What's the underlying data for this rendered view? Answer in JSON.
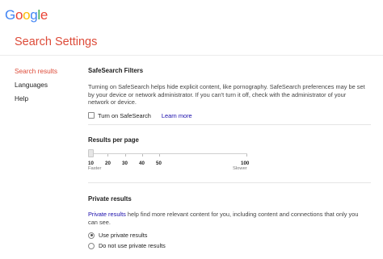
{
  "logo": {
    "text": "Google",
    "letters": [
      "G",
      "o",
      "o",
      "g",
      "l",
      "e"
    ],
    "colors": [
      "#4285F4",
      "#EA4335",
      "#FBBC05",
      "#4285F4",
      "#34A853",
      "#EA4335"
    ]
  },
  "page": {
    "title": "Search Settings"
  },
  "sidebar": {
    "items": [
      {
        "label": "Search results",
        "active": true
      },
      {
        "label": "Languages",
        "active": false
      },
      {
        "label": "Help",
        "active": false
      }
    ]
  },
  "safesearch": {
    "title": "SafeSearch Filters",
    "description": "Turning on SafeSearch helps hide explicit content, like pornography. SafeSearch preferences may be set by your device or network administrator. If you can't turn it off, check with the administrator of your network or device.",
    "checkbox_label": "Turn on SafeSearch",
    "learn_more": "Learn more",
    "checked": false
  },
  "results_per_page": {
    "title": "Results per page",
    "ticks": [
      "10",
      "20",
      "30",
      "40",
      "50",
      "100"
    ],
    "selected": "10",
    "left_label": "Faster",
    "right_label": "Slower"
  },
  "private_results": {
    "title": "Private results",
    "link_text": "Private results",
    "description_rest": " help find more relevant content for you, including content and connections that only you can see.",
    "options": [
      "Use private results",
      "Do not use private results"
    ],
    "selected": 0
  }
}
